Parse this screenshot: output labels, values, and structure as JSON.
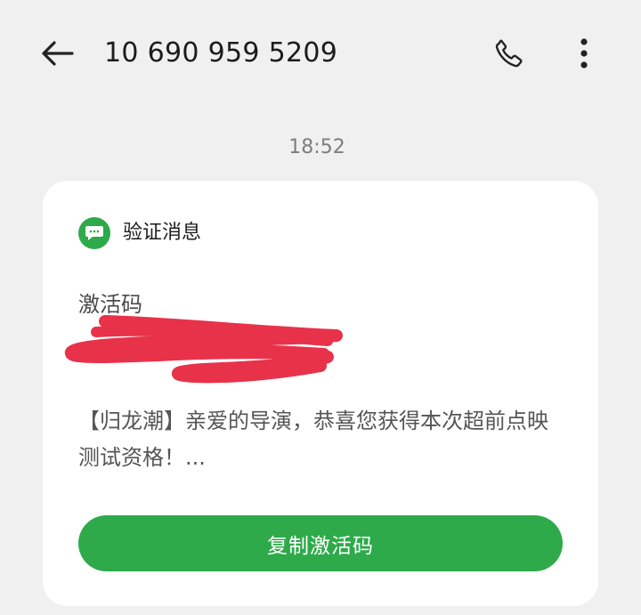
{
  "header": {
    "title": "10 690 959 5209",
    "back_icon": "arrow-left-icon",
    "call_icon": "phone-icon",
    "more_icon": "more-vertical-icon"
  },
  "timestamp": "18:52",
  "card": {
    "label": "验证消息",
    "label_icon": "message-bubble-icon",
    "code_label": "激活码",
    "body": "【归龙潮】亲爱的导演，恭喜您获得本次超前点映测试资格！...",
    "copy_button": "复制激活码"
  },
  "colors": {
    "background": "#f0f0f0",
    "accent": "#2eaa4a",
    "redaction": "#e8324a"
  }
}
